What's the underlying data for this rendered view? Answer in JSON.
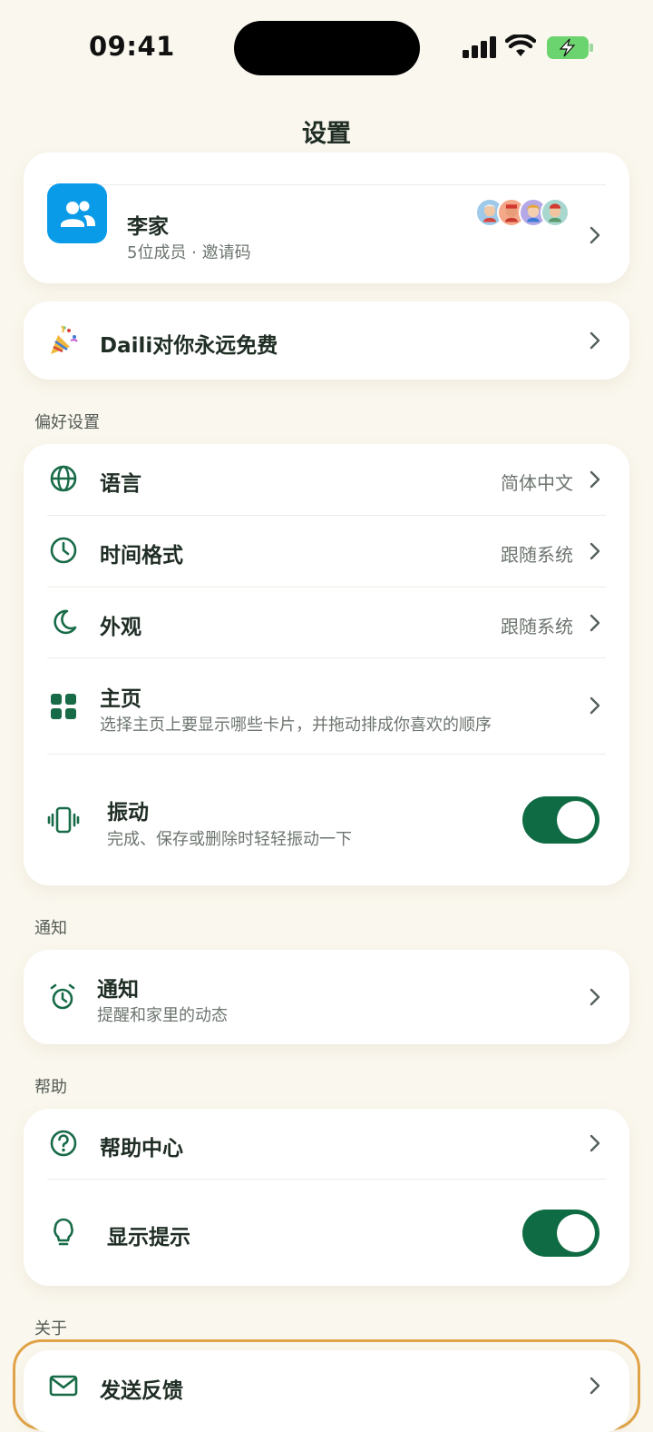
{
  "status_bar": {
    "time": "09:41"
  },
  "header": {
    "title": "设置"
  },
  "family": {
    "name": "李家",
    "info": "5位成员 · 邀请码"
  },
  "promo": {
    "label": "Daili对你永远免费"
  },
  "sections": {
    "preferences": "偏好设置",
    "notifications": "通知",
    "help": "帮助",
    "about": "关于"
  },
  "preferences": {
    "language": {
      "label": "语言",
      "value": "简体中文"
    },
    "time_format": {
      "label": "时间格式",
      "value": "跟随系统"
    },
    "appearance": {
      "label": "外观",
      "value": "跟随系统"
    },
    "home": {
      "label": "主页",
      "desc": "选择主页上要显示哪些卡片，并拖动排成你喜欢的顺序"
    },
    "vibration": {
      "label": "振动",
      "desc": "完成、保存或删除时轻轻振动一下",
      "enabled": true
    }
  },
  "notifications": {
    "label": "通知",
    "desc": "提醒和家里的动态"
  },
  "help": {
    "help_center": {
      "label": "帮助中心"
    },
    "show_tips": {
      "label": "显示提示",
      "enabled": true
    }
  },
  "about": {
    "feedback": {
      "label": "发送反馈"
    }
  },
  "colors": {
    "accent": "#0f6b43",
    "background": "#faf7ee",
    "family_icon": "#0a9be8",
    "highlight": "#e0a347"
  },
  "icons": [
    "family-icon",
    "party-popper-icon",
    "globe-icon",
    "clock-icon",
    "moon-icon",
    "grid-icon",
    "vibration-icon",
    "alarm-clock-icon",
    "question-circle-icon",
    "lightbulb-icon",
    "mail-icon",
    "chevron-right-icon"
  ]
}
